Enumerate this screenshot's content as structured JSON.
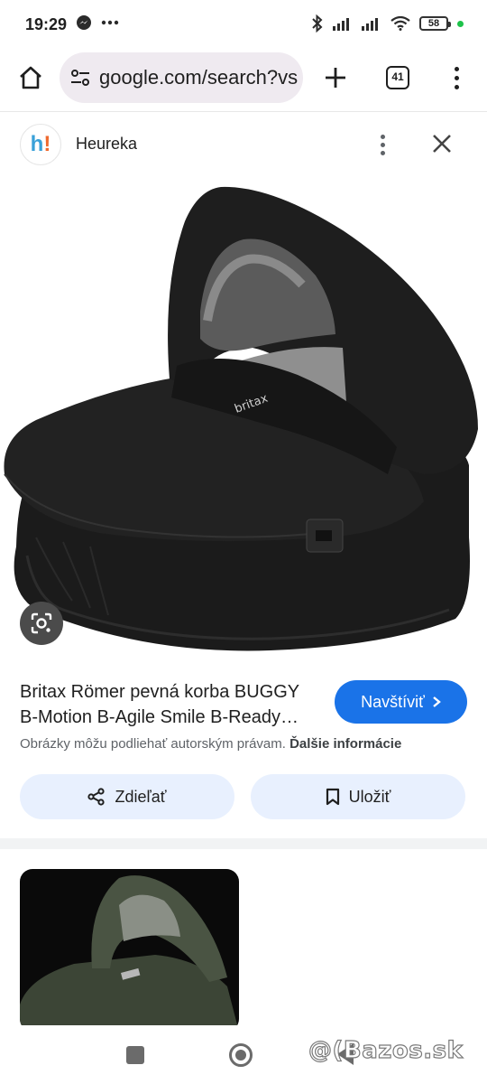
{
  "status_bar": {
    "time": "19:29",
    "battery_level": "58",
    "icons": [
      "messenger-icon",
      "more-dots-icon",
      "bluetooth-icon",
      "signal-icon",
      "signal-icon-2",
      "wifi-icon",
      "battery-icon"
    ]
  },
  "browser": {
    "url": "google.com/search?vs",
    "tab_count": "41"
  },
  "source": {
    "favicon_letters": "h!",
    "name": "Heureka"
  },
  "product": {
    "title_line1": "Britax Römer pevná korba BUGGY",
    "title_line2": "B-Motion B-Agile Smile B-Ready…",
    "visit_label": "Navštíviť",
    "caption_text": "Obrázky môžu podliehať autorským právam.",
    "caption_link": "Ďalšie informácie",
    "share_label": "Zdieľať",
    "save_label": "Uložiť",
    "brand_mark": "britax"
  },
  "watermark": {
    "text": "@(Bazos.sk"
  },
  "colors": {
    "accent_blue": "#1a73e8",
    "pill_bg": "#e8f0fe",
    "url_pill_bg": "#efeaf0",
    "status_green": "#1ec24a"
  }
}
